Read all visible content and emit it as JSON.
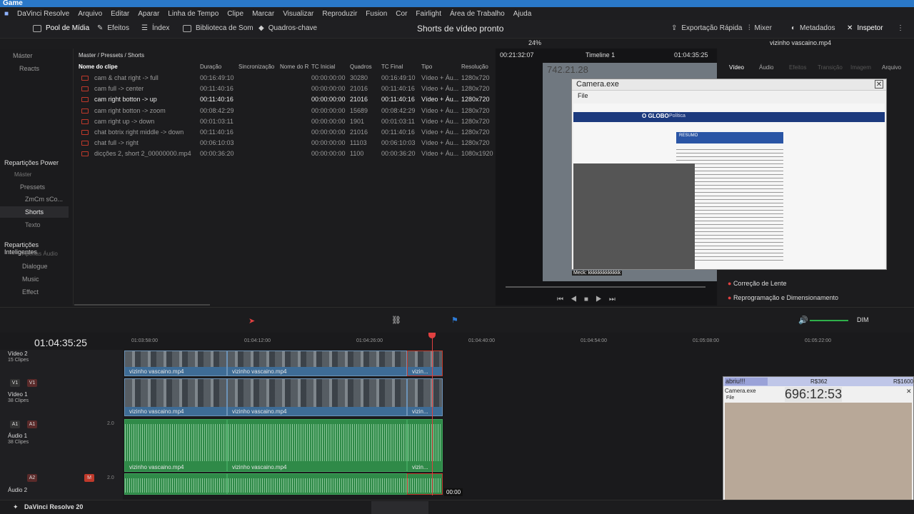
{
  "window": {
    "title": "Game"
  },
  "menu": [
    "DaVinci Resolve",
    "Arquivo",
    "Editar",
    "Aparar",
    "Linha de Tempo",
    "Clipe",
    "Marcar",
    "Visualizar",
    "Reproduzir",
    "Fusion",
    "Cor",
    "Fairlight",
    "Área de Trabalho",
    "Ajuda"
  ],
  "toolbar": {
    "media_pool": "Pool de Mídia",
    "effects": "Efeitos",
    "index": "Índex",
    "sound_library": "Biblioteca de Som",
    "keyframes": "Quadros-chave",
    "project_title": "Shorts de vídeo pronto",
    "quick_export": "Exportação Rápida",
    "mixer": "Mixer",
    "metadata": "Metadados",
    "inspector": "Inspetor"
  },
  "viewer_bar": {
    "zoom": "24%",
    "source_tc": "00:21:32:07",
    "timeline_name": "Timeline 1",
    "timeline_tc": "01:04:35:25",
    "clip_name": "vizinho vascaino.mp4"
  },
  "bins": {
    "master": "Máster",
    "reacts": "Reacts",
    "power_title": "Repartições Power",
    "power_items": [
      "Máster",
      "Pressets",
      "ZmCm sCo...",
      "Shorts",
      "Texto"
    ],
    "smart_title": "Repartições Inteligentes",
    "smart_items": [
      "Apenas Áudio",
      "Dialogue",
      "Music",
      "Effect"
    ]
  },
  "pool": {
    "breadcrumb": "Master / Pressets / Shorts",
    "columns": [
      "Nome do clipe",
      "Duração",
      "Sincronização",
      "Nome do R",
      "TC Inicial",
      "Quadros",
      "TC Final",
      "Tipo",
      "Resolução"
    ],
    "rows": [
      {
        "name": "cam & chat right -> full",
        "dur": "00:16:49:10",
        "tcin": "00:00:00:00",
        "frames": "30280",
        "tcout": "00:16:49:10",
        "type": "Vídeo + Áu...",
        "res": "1280x720"
      },
      {
        "name": "cam full -> center",
        "dur": "00:11:40:16",
        "tcin": "00:00:00:00",
        "frames": "21016",
        "tcout": "00:11:40:16",
        "type": "Vídeo + Áu...",
        "res": "1280x720"
      },
      {
        "name": "cam right botton -> up",
        "dur": "00:11:40:16",
        "tcin": "00:00:00:00",
        "frames": "21016",
        "tcout": "00:11:40:16",
        "type": "Vídeo + Áu...",
        "res": "1280x720"
      },
      {
        "name": "cam right botton -> zoom",
        "dur": "00:08:42:29",
        "tcin": "00:00:00:00",
        "frames": "15689",
        "tcout": "00:08:42:29",
        "type": "Vídeo + Áu...",
        "res": "1280x720"
      },
      {
        "name": "cam right up -> down",
        "dur": "00:01:03:11",
        "tcin": "00:00:00:00",
        "frames": "1901",
        "tcout": "00:01:03:11",
        "type": "Vídeo + Áu...",
        "res": "1280x720"
      },
      {
        "name": "chat botrix right middle -> down",
        "dur": "00:11:40:16",
        "tcin": "00:00:00:00",
        "frames": "21016",
        "tcout": "00:11:40:16",
        "type": "Vídeo + Áu...",
        "res": "1280x720"
      },
      {
        "name": "chat full -> right",
        "dur": "00:06:10:03",
        "tcin": "00:00:00:00",
        "frames": "11103",
        "tcout": "00:06:10:03",
        "type": "Vídeo + Áu...",
        "res": "1280x720"
      },
      {
        "name": "dicções 2, short 2_00000000.mp4",
        "dur": "00:00:36:20",
        "tcin": "00:00:00:00",
        "frames": "1100",
        "tcout": "00:00:36:20",
        "type": "Vídeo + Áu...",
        "res": "1080x1920"
      }
    ]
  },
  "inspector": {
    "tabs": [
      "Vídeo",
      "Áudio",
      "Efeitos",
      "Transição",
      "Imagem",
      "Arquivo"
    ],
    "lens": "Correção de Lente",
    "reframe": "Reprogramação e Dimensionamento"
  },
  "camera_window": {
    "title": "Camera.exe",
    "menu": "File",
    "counter_top": "742.21.28",
    "news_brand": "O GLOBO",
    "news_section": "Política",
    "news_box": "RESUMO",
    "chat_line": "Meck: kkkkkkkkkkkkk"
  },
  "timeline": {
    "timecode": "01:04:35:25",
    "ruler": [
      "01:03:58:00",
      "01:04:12:00",
      "01:04:26:00",
      "01:04:40:00",
      "01:04:54:00",
      "01:05:08:00",
      "01:05:22:00"
    ],
    "tracks": [
      {
        "name": "Vídeo 2",
        "clips": "15 Clipes"
      },
      {
        "name": "Vídeo 1",
        "clips": "38 Clipes",
        "badges": [
          "V1",
          "V1"
        ]
      },
      {
        "name": "Áudio 1",
        "clips": "38 Clipes",
        "badges": [
          "A1",
          "A1"
        ],
        "level": "2.0"
      },
      {
        "name": "Áudio 2",
        "clips": "",
        "badges": [
          "A2"
        ],
        "level": "2.0"
      }
    ],
    "clip_label": "vizinho vascaino.mp4",
    "clip_short": "vizin...",
    "hover_tc": "00:00",
    "dim": "DIM"
  },
  "overlay2": {
    "alert": "abriu!!!",
    "r1": "R$362",
    "r2": "R$1600",
    "title": "Camera.exe",
    "menu": "File",
    "counter": "696:12:53"
  },
  "status": {
    "app": "DaVinci Resolve 20"
  }
}
